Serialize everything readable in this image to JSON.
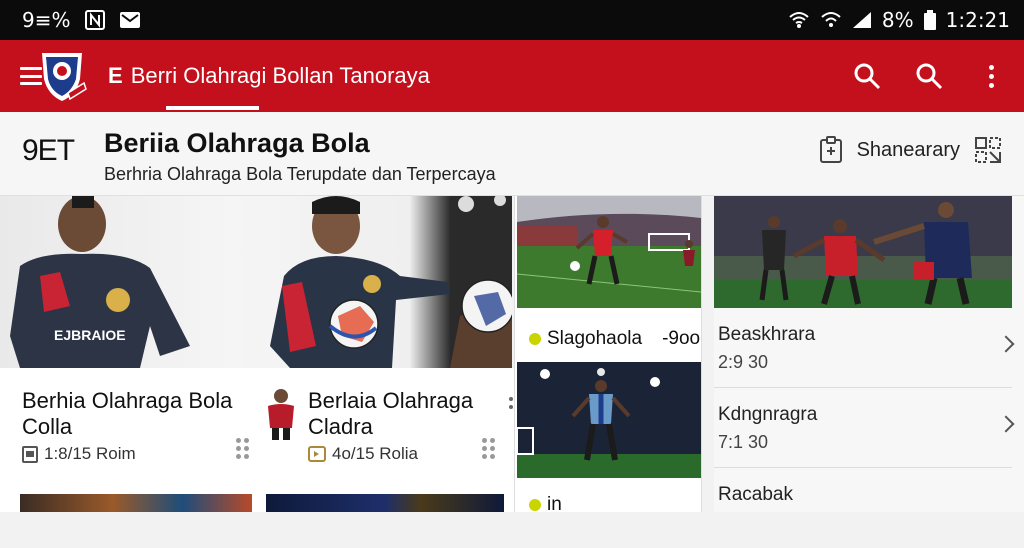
{
  "status_bar": {
    "left_text": "9≡%",
    "battery": "8%",
    "time": "1:2:21"
  },
  "app_bar": {
    "title_prefix": "E",
    "title": "Berri Olahragi Bollan Tanoraya"
  },
  "header": {
    "brand_code": "9ET",
    "title": "Beriia Olahraga Bola",
    "subtitle": "Berhria Olahraga Bola Terupdate dan Terpercaya",
    "share_label": "Shanearary"
  },
  "cards": [
    {
      "title_line1": "Berhia Olahraga Bola",
      "title_line2": "Colla",
      "meta": "1:8/15 Roim"
    },
    {
      "title_line1": "Berlaia Olahraga",
      "title_line2": "Cladra",
      "meta": "4o/15 Rolia"
    }
  ],
  "middle": {
    "item1_label": "Slagohaola",
    "item1_suffix": "-9oo",
    "item2_label": "in"
  },
  "list": [
    {
      "title": "Beaskhrara",
      "subtitle": "2:9 30"
    },
    {
      "title": "Kdngnragra",
      "subtitle": "7:1 30"
    },
    {
      "title": "Racabak",
      "subtitle": ""
    }
  ],
  "colors": {
    "brand_red": "#c4101c",
    "status_bg": "#0b0b0b",
    "accent_yellow": "#c9d400"
  },
  "icons": [
    "menu-icon",
    "app-logo",
    "search-icon",
    "kebab-menu-icon",
    "clipboard-icon",
    "share-icon",
    "chevron-right-icon",
    "wifi-icon",
    "signal-icon",
    "battery-icon",
    "notification-icon"
  ]
}
